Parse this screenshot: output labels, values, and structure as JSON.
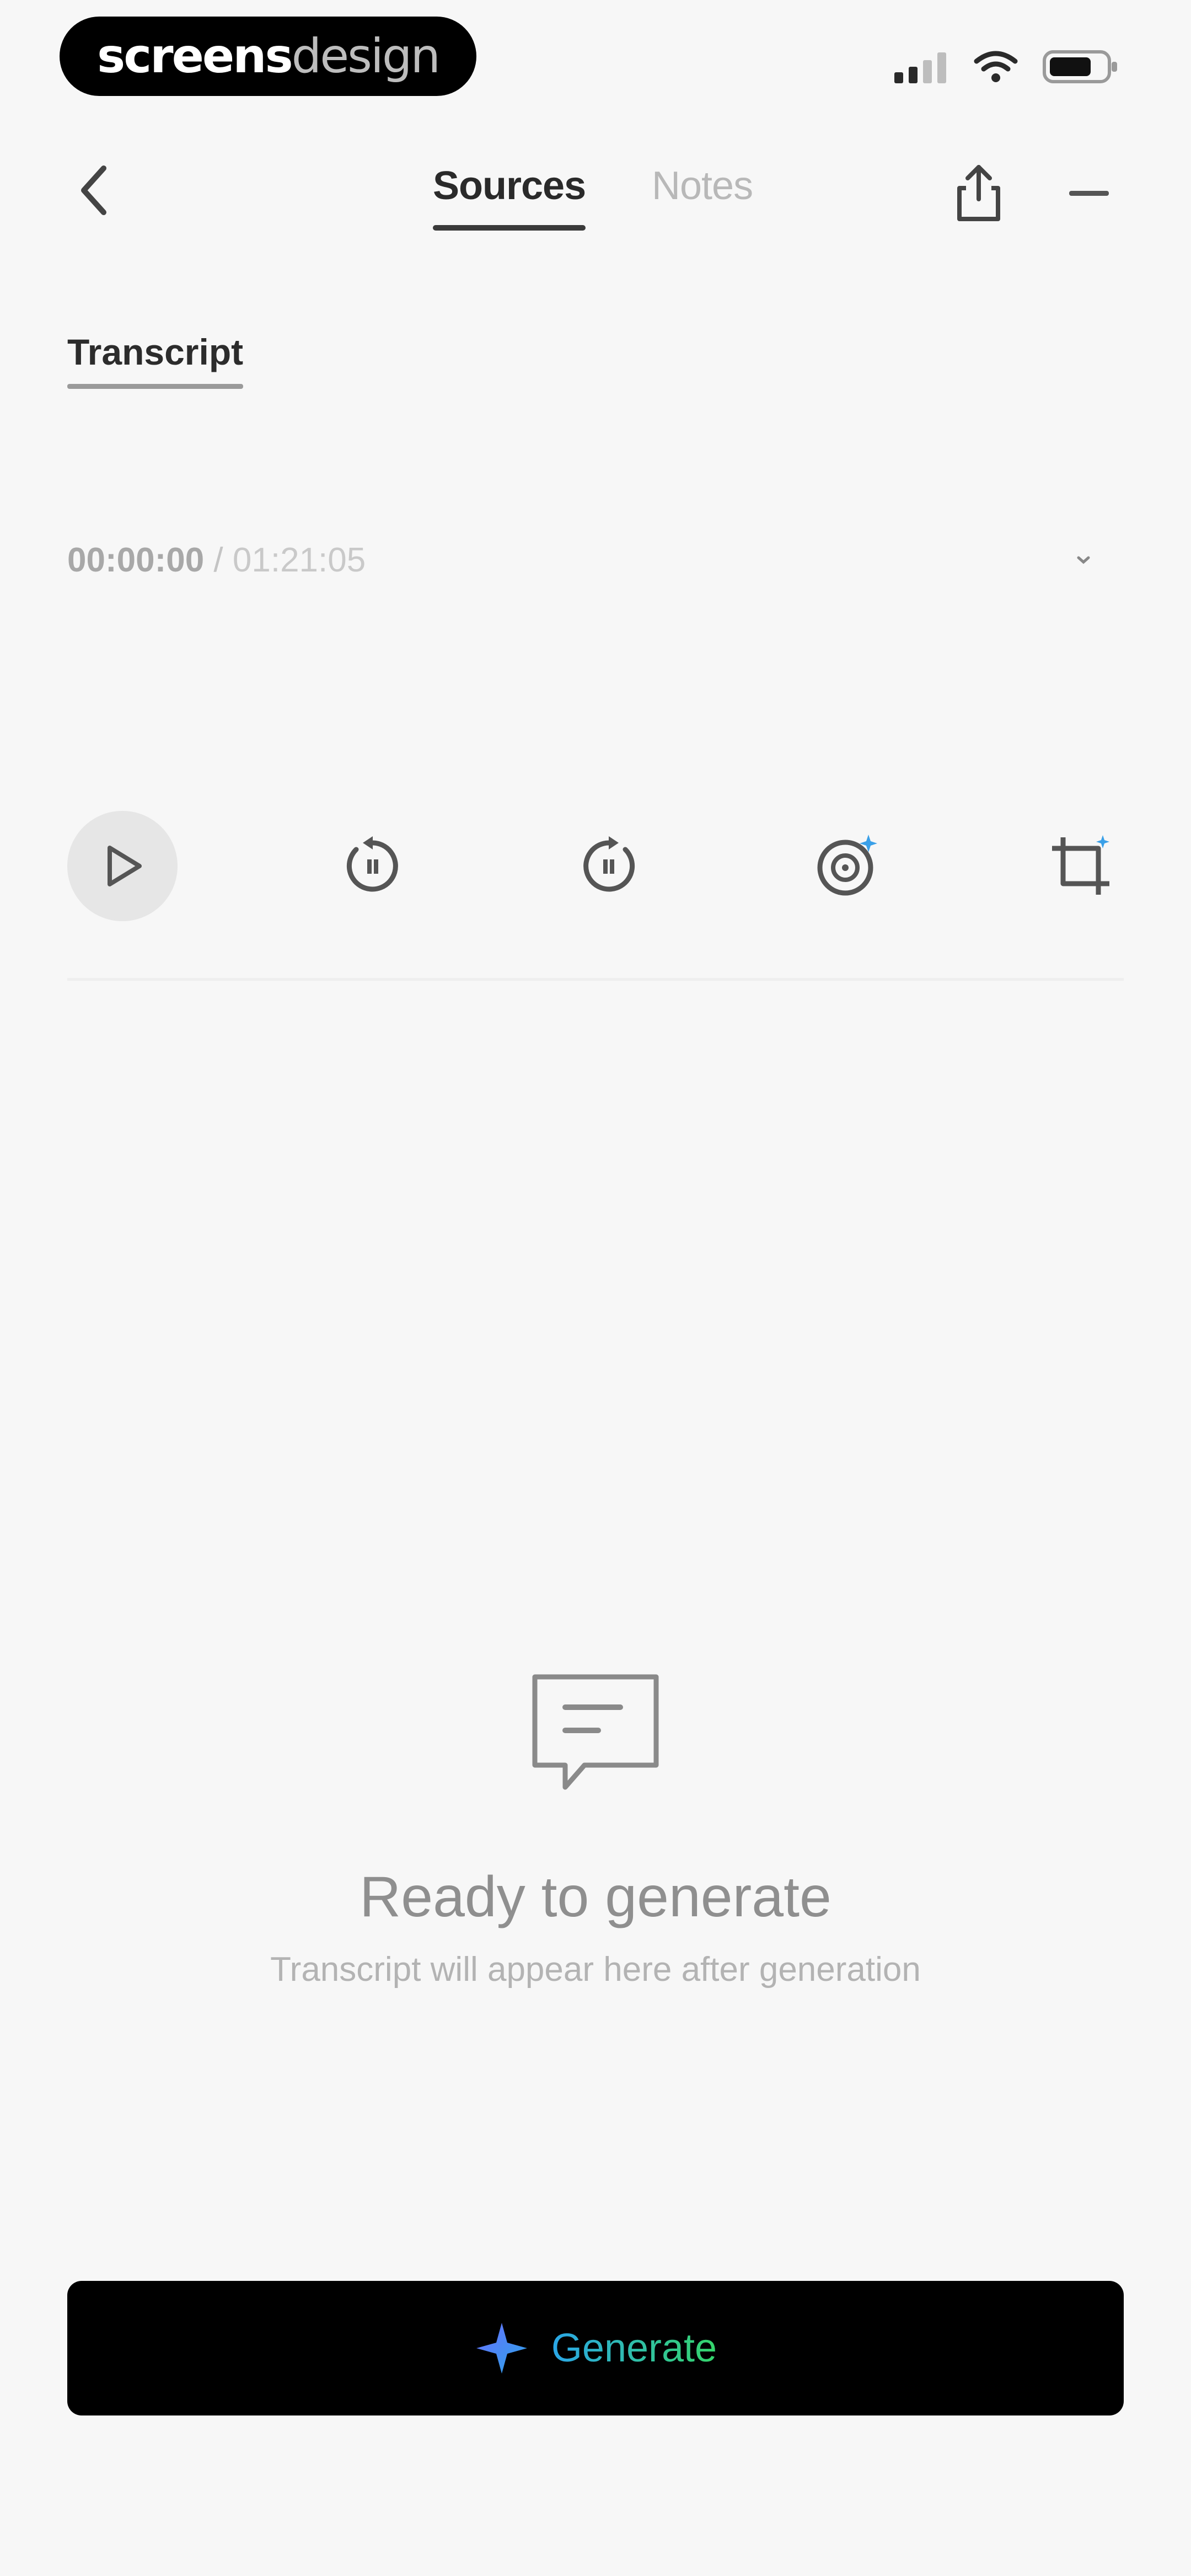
{
  "status_bar": {
    "brand_part1": "screens",
    "brand_part2": "design"
  },
  "nav": {
    "tabs": [
      {
        "label": "Sources",
        "active": true
      },
      {
        "label": "Notes",
        "active": false
      }
    ],
    "icons": {
      "back": "chevron-left-icon",
      "share": "share-icon",
      "more": "more-horizontal-icon"
    }
  },
  "transcript": {
    "label": "Transcript",
    "time_current": "00:00:00",
    "time_separator": " / ",
    "time_total": "01:21:05"
  },
  "controls": {
    "icons": [
      "play-icon",
      "rewind-icon",
      "fast-forward-icon",
      "ai-target-icon",
      "crop-icon"
    ]
  },
  "empty_state": {
    "title": "Ready to generate",
    "subtitle": "Transcript will appear here after generation"
  },
  "generate": {
    "label": "Generate"
  },
  "colors": {
    "background": "#f7f7f7",
    "accent_blue": "#2aa6e8",
    "accent_green": "#35d56a",
    "button_bg": "#000000"
  }
}
